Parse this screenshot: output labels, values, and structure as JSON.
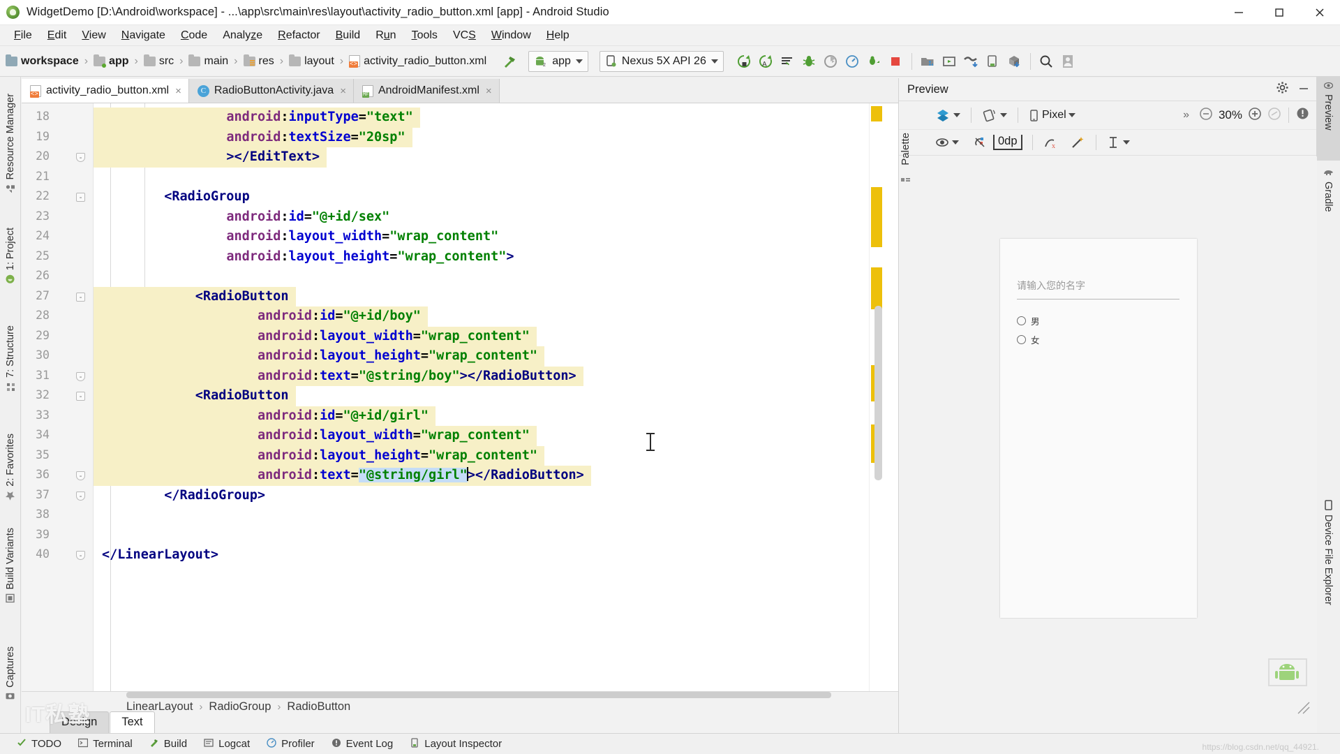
{
  "window": {
    "title": "WidgetDemo [D:\\Android\\workspace] - ...\\app\\src\\main\\res\\layout\\activity_radio_button.xml [app] - Android Studio",
    "logo_icon": "android-studio-logo",
    "minimize_icon": "minimize-icon",
    "maximize_icon": "maximize-icon",
    "close_icon": "close-icon"
  },
  "menubar": {
    "items": [
      {
        "label": "File",
        "mnemonic": "F"
      },
      {
        "label": "Edit",
        "mnemonic": "E"
      },
      {
        "label": "View",
        "mnemonic": "V"
      },
      {
        "label": "Navigate",
        "mnemonic": "N"
      },
      {
        "label": "Code",
        "mnemonic": "C"
      },
      {
        "label": "Analyze",
        "mnemonic": "z"
      },
      {
        "label": "Refactor",
        "mnemonic": "R"
      },
      {
        "label": "Build",
        "mnemonic": "B"
      },
      {
        "label": "Run",
        "mnemonic": "u"
      },
      {
        "label": "Tools",
        "mnemonic": "T"
      },
      {
        "label": "VCS",
        "mnemonic": "S"
      },
      {
        "label": "Window",
        "mnemonic": "W"
      },
      {
        "label": "Help",
        "mnemonic": "H"
      }
    ]
  },
  "navbar": {
    "crumbs": [
      {
        "label": "workspace",
        "icon": "workspace-folder-icon"
      },
      {
        "label": "app",
        "icon": "module-folder-icon"
      },
      {
        "label": "src",
        "icon": "folder-icon"
      },
      {
        "label": "main",
        "icon": "folder-icon"
      },
      {
        "label": "res",
        "icon": "res-folder-icon"
      },
      {
        "label": "layout",
        "icon": "folder-icon"
      },
      {
        "label": "activity_radio_button.xml",
        "icon": "xml-file-icon"
      }
    ],
    "build_icon": "hammer-icon",
    "run_config": {
      "label": "app",
      "icon": "android-app-icon",
      "caret": "chevron-down-icon"
    },
    "device": {
      "label": "Nexus 5X API 26",
      "icon": "device-icon",
      "caret": "chevron-down-icon"
    },
    "actions": [
      {
        "name": "run-button",
        "icon": "run-icon"
      },
      {
        "name": "apply-changes-button",
        "icon": "apply-changes-icon"
      },
      {
        "name": "apply-code-changes-button",
        "icon": "apply-code-changes-icon"
      },
      {
        "name": "debug-button",
        "icon": "debug-icon"
      },
      {
        "name": "run-with-coverage-button",
        "icon": "coverage-icon"
      },
      {
        "name": "profiler-button",
        "icon": "profiler-icon"
      },
      {
        "name": "attach-debugger-button",
        "icon": "attach-debugger-icon"
      },
      {
        "name": "stop-button",
        "icon": "stop-icon"
      },
      {
        "name": "sdk-manager-button",
        "icon": "sdk-manager-icon"
      },
      {
        "name": "avd-manager-button",
        "icon": "avd-manager-icon"
      },
      {
        "name": "sync-gradle-button",
        "icon": "gradle-sync-icon"
      },
      {
        "name": "layout-inspector-button",
        "icon": "layout-inspector-icon"
      },
      {
        "name": "sdk-download-button",
        "icon": "sdk-download-icon"
      },
      {
        "name": "search-everywhere-button",
        "icon": "search-icon"
      },
      {
        "name": "account-button",
        "icon": "account-icon"
      }
    ]
  },
  "left_tool_strip": {
    "items": [
      {
        "label": "Resource Manager",
        "icon": "resource-manager-icon"
      },
      {
        "label": "1: Project",
        "icon": "project-icon"
      },
      {
        "label": "7: Structure",
        "icon": "structure-icon"
      },
      {
        "label": "2: Favorites",
        "icon": "favorites-star-icon"
      },
      {
        "label": "Build Variants",
        "icon": "build-variants-icon"
      },
      {
        "label": "Captures",
        "icon": "captures-icon"
      }
    ]
  },
  "right_tool_strip": {
    "items": [
      {
        "label": "Preview",
        "icon": "preview-eye-icon",
        "active": true
      },
      {
        "label": "Gradle",
        "icon": "gradle-elephant-icon",
        "active": false
      },
      {
        "label": "Device File Explorer",
        "icon": "device-icon",
        "active": false
      }
    ]
  },
  "editor_tabs": [
    {
      "label": "activity_radio_button.xml",
      "icon": "xml-file-icon",
      "active": true,
      "close_icon": "close-icon"
    },
    {
      "label": "RadioButtonActivity.java",
      "icon": "java-class-icon",
      "active": false,
      "close_icon": "close-icon"
    },
    {
      "label": "AndroidManifest.xml",
      "icon": "manifest-file-icon",
      "active": false,
      "close_icon": "close-icon"
    }
  ],
  "editor": {
    "first_line": 18,
    "lines": [
      {
        "num": 18,
        "indent": 4,
        "highlight": true,
        "fold": null,
        "tokens": [
          {
            "t": "attr",
            "v": "android:inputType"
          },
          {
            "t": "eq",
            "v": "="
          },
          {
            "t": "val",
            "v": "\"text\""
          }
        ]
      },
      {
        "num": 19,
        "indent": 4,
        "highlight": true,
        "fold": null,
        "tokens": [
          {
            "t": "attr",
            "v": "android:textSize"
          },
          {
            "t": "eq",
            "v": "="
          },
          {
            "t": "val",
            "v": "\"20sp\""
          }
        ]
      },
      {
        "num": 20,
        "indent": 4,
        "highlight": true,
        "fold": "tail",
        "tokens": [
          {
            "t": "tag",
            "v": "></EditText>"
          }
        ]
      },
      {
        "num": 21,
        "indent": 0,
        "highlight": false,
        "fold": null,
        "tokens": []
      },
      {
        "num": 22,
        "indent": 2,
        "highlight": false,
        "fold": "head",
        "tokens": [
          {
            "t": "tag",
            "v": "<RadioGroup"
          }
        ]
      },
      {
        "num": 23,
        "indent": 4,
        "highlight": false,
        "fold": null,
        "tokens": [
          {
            "t": "attr",
            "v": "android:id"
          },
          {
            "t": "eq",
            "v": "="
          },
          {
            "t": "val",
            "v": "\"@+id/sex\""
          }
        ]
      },
      {
        "num": 24,
        "indent": 4,
        "highlight": false,
        "fold": null,
        "tokens": [
          {
            "t": "attr",
            "v": "android:layout_width"
          },
          {
            "t": "eq",
            "v": "="
          },
          {
            "t": "val",
            "v": "\"wrap_content\""
          }
        ]
      },
      {
        "num": 25,
        "indent": 4,
        "highlight": false,
        "fold": null,
        "tokens": [
          {
            "t": "attr",
            "v": "android:layout_height"
          },
          {
            "t": "eq",
            "v": "="
          },
          {
            "t": "val",
            "v": "\"wrap_content\""
          },
          {
            "t": "tag",
            "v": ">"
          }
        ]
      },
      {
        "num": 26,
        "indent": 0,
        "highlight": false,
        "fold": null,
        "tokens": []
      },
      {
        "num": 27,
        "indent": 3,
        "highlight": true,
        "fold": "head",
        "tokens": [
          {
            "t": "tag",
            "v": "<RadioButton"
          }
        ]
      },
      {
        "num": 28,
        "indent": 5,
        "highlight": true,
        "fold": null,
        "tokens": [
          {
            "t": "attr",
            "v": "android:id"
          },
          {
            "t": "eq",
            "v": "="
          },
          {
            "t": "val",
            "v": "\"@+id/boy\""
          }
        ]
      },
      {
        "num": 29,
        "indent": 5,
        "highlight": true,
        "fold": null,
        "tokens": [
          {
            "t": "attr",
            "v": "android:layout_width"
          },
          {
            "t": "eq",
            "v": "="
          },
          {
            "t": "val",
            "v": "\"wrap_content\""
          }
        ]
      },
      {
        "num": 30,
        "indent": 5,
        "highlight": true,
        "fold": null,
        "tokens": [
          {
            "t": "attr",
            "v": "android:layout_height"
          },
          {
            "t": "eq",
            "v": "="
          },
          {
            "t": "val",
            "v": "\"wrap_content\""
          }
        ]
      },
      {
        "num": 31,
        "indent": 5,
        "highlight": true,
        "fold": "tail",
        "tokens": [
          {
            "t": "attr",
            "v": "android:text"
          },
          {
            "t": "eq",
            "v": "="
          },
          {
            "t": "val",
            "v": "\"@string/boy\""
          },
          {
            "t": "tag",
            "v": "></RadioButton>"
          }
        ]
      },
      {
        "num": 32,
        "indent": 3,
        "highlight": true,
        "fold": "head",
        "tokens": [
          {
            "t": "tag",
            "v": "<RadioButton"
          }
        ]
      },
      {
        "num": 33,
        "indent": 5,
        "highlight": true,
        "fold": null,
        "tokens": [
          {
            "t": "attr",
            "v": "android:id"
          },
          {
            "t": "eq",
            "v": "="
          },
          {
            "t": "val",
            "v": "\"@+id/girl\""
          }
        ]
      },
      {
        "num": 34,
        "indent": 5,
        "highlight": true,
        "fold": null,
        "tokens": [
          {
            "t": "attr",
            "v": "android:layout_width"
          },
          {
            "t": "eq",
            "v": "="
          },
          {
            "t": "val",
            "v": "\"wrap_content\""
          }
        ]
      },
      {
        "num": 35,
        "indent": 5,
        "highlight": true,
        "fold": null,
        "tokens": [
          {
            "t": "attr",
            "v": "android:layout_height"
          },
          {
            "t": "eq",
            "v": "="
          },
          {
            "t": "val",
            "v": "\"wrap_content\""
          }
        ]
      },
      {
        "num": 36,
        "indent": 5,
        "highlight": true,
        "fold": "tail",
        "tokens": [
          {
            "t": "attr",
            "v": "android:text"
          },
          {
            "t": "eq",
            "v": "="
          },
          {
            "t": "sel",
            "v": "\"@string/girl\""
          },
          {
            "t": "tag",
            "v": "></RadioButton>"
          }
        ]
      },
      {
        "num": 37,
        "indent": 2,
        "highlight": false,
        "fold": "tail",
        "tokens": [
          {
            "t": "tag",
            "v": "</RadioGroup>"
          }
        ]
      },
      {
        "num": 38,
        "indent": 0,
        "highlight": false,
        "fold": null,
        "tokens": []
      },
      {
        "num": 39,
        "indent": 0,
        "highlight": false,
        "fold": null,
        "tokens": []
      },
      {
        "num": 40,
        "indent": 0,
        "highlight": false,
        "fold": "tail",
        "tokens": [
          {
            "t": "tag",
            "v": "</LinearLayout>"
          }
        ]
      }
    ],
    "selection_text": "\"@string/girl\"",
    "colors": {
      "tag": "#000080",
      "attribute": "#7d2a7d",
      "value": "#008000",
      "highlight_row": "#f7f0c7",
      "selection": "#c5ddf7",
      "warning_marker": "#edc00b"
    }
  },
  "editor_breadcrumb": {
    "items": [
      "LinearLayout",
      "RadioGroup",
      "RadioButton"
    ],
    "separator": "›"
  },
  "editor_mode_tabs": [
    {
      "label": "Design",
      "active": false
    },
    {
      "label": "Text",
      "active": true
    }
  ],
  "watermark": {
    "text": "IT私塾"
  },
  "preview": {
    "title": "Preview",
    "settings_icon": "gear-icon",
    "minimize_icon": "minimize-icon",
    "palette_label": "Palette",
    "toolbar": {
      "render_mode": {
        "icon": "layers-icon",
        "caret": "chevron-down-icon"
      },
      "orientation": {
        "icon": "rotate-icon",
        "caret": "chevron-down-icon"
      },
      "device": {
        "icon": "phone-icon",
        "label": "Pixel",
        "caret": "chevron-down-icon"
      },
      "overflow": "»",
      "zoom_out_icon": "zoom-out-icon",
      "zoom_level": "30%",
      "zoom_in_icon": "zoom-in-icon",
      "zoom_fit_icon": "zoom-to-fit-icon",
      "issues_icon": "warning-icon"
    },
    "toolbar2": {
      "visibility": {
        "icon": "eye-icon",
        "caret": "chevron-down-icon"
      },
      "clear_constraints_icon": "clear-constraints-icon",
      "default_margin": "0dp",
      "infer_constraints_icon": "infer-constraints-icon",
      "magic_icon": "magic-wand-icon",
      "guidelines": {
        "icon": "guideline-icon",
        "caret": "chevron-down-icon"
      }
    },
    "device_screen": {
      "edit_text_hint": "请输入您的名字",
      "radio_buttons": [
        {
          "label": "男",
          "checked": false
        },
        {
          "label": "女",
          "checked": false
        }
      ]
    },
    "resize_grip_icon": "resize-grip-icon"
  },
  "bottom_windows": [
    {
      "label": "TODO",
      "icon": "todo-icon"
    },
    {
      "label": "Terminal",
      "icon": "terminal-icon"
    },
    {
      "label": "Build",
      "icon": "build-icon"
    },
    {
      "label": "Logcat",
      "icon": "logcat-icon"
    },
    {
      "label": "Profiler",
      "icon": "profiler-icon"
    },
    {
      "label": "Event Log",
      "icon": "event-log-icon"
    },
    {
      "label": "Layout Inspector",
      "icon": "layout-inspector-icon"
    }
  ]
}
